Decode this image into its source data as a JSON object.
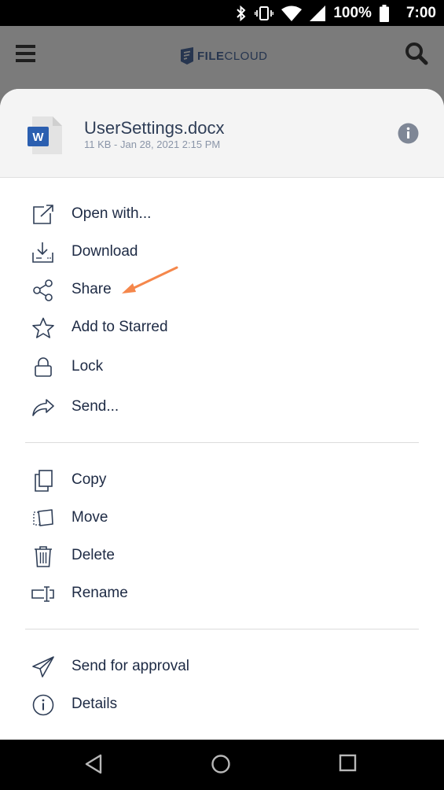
{
  "status_bar": {
    "battery": "100%",
    "time": "7:00",
    "icons": [
      "bluetooth-icon",
      "vibrate-icon",
      "wifi-icon",
      "signal-icon",
      "battery-icon"
    ]
  },
  "app_bar": {
    "logo_text_bold": "FILE",
    "logo_text_rest": "CLOUD",
    "icons": [
      "menu-icon",
      "search-icon"
    ]
  },
  "file": {
    "name": "UserSettings.docx",
    "meta": "11 KB - Jan 28, 2021 2:15 PM",
    "type_badge": "W"
  },
  "menu": {
    "group1": [
      {
        "label": "Open with...",
        "icon": "open-external-icon"
      },
      {
        "label": "Download",
        "icon": "download-icon"
      },
      {
        "label": "Share",
        "icon": "share-icon"
      },
      {
        "label": "Add to Starred",
        "icon": "star-icon"
      },
      {
        "label": "Lock",
        "icon": "lock-icon"
      },
      {
        "label": "Send...",
        "icon": "forward-icon"
      }
    ],
    "group2": [
      {
        "label": "Copy",
        "icon": "copy-icon"
      },
      {
        "label": "Move",
        "icon": "move-icon"
      },
      {
        "label": "Delete",
        "icon": "trash-icon"
      },
      {
        "label": "Rename",
        "icon": "rename-icon"
      }
    ],
    "group3": [
      {
        "label": "Send for approval",
        "icon": "paper-plane-icon"
      },
      {
        "label": "Details",
        "icon": "info-icon"
      }
    ]
  },
  "colors": {
    "accent_arrow": "#f5874b",
    "icon_color": "#2f3e57",
    "word_blue": "#2b5fb0"
  }
}
